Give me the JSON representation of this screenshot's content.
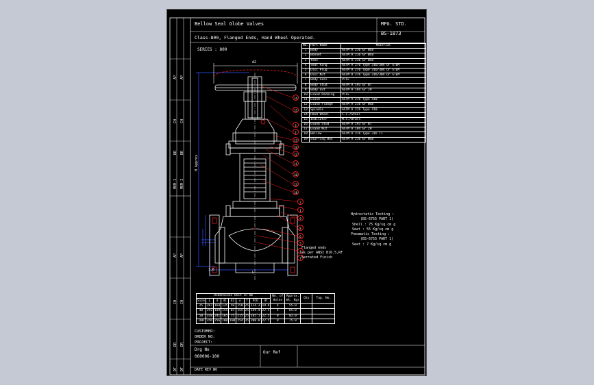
{
  "header": {
    "title": "Bellow Seal Globe Valves",
    "subtitle": "Class-800, Flanged Ends, Hand Wheel Operated.",
    "std_label": "MFG. STD.",
    "std_value": "BS-1873",
    "series": "SERIES : 800"
  },
  "parts_table": {
    "headers": [
      "No.",
      "Part Name",
      "Material"
    ],
    "rows": [
      [
        "1",
        "Body",
        "ASTM A 216 Gr WCB"
      ],
      [
        "2",
        "Bonnet",
        "ASTM A 216 Gr WCB"
      ],
      [
        "3",
        "Yoke",
        "ASTM A 216 Gr WCB"
      ],
      [
        "4",
        "Seat Ring",
        "ASTM A 276 Type 316/304 Or STEM"
      ],
      [
        "5",
        "Disc Plug",
        "ASTM A 276 Type 316/304 Or STEM"
      ],
      [
        "6",
        "Disc Nut",
        "ASTM A 276 Type 316/304 Or STEM"
      ],
      [
        "7",
        "Body Seal",
        "PTFE"
      ],
      [
        "8",
        "Body Stud",
        "ASTM A 193 Gr B7"
      ],
      [
        "9",
        "Body nut",
        "ASTM A 194 Gr 2H"
      ],
      [
        "10",
        "Gland Packing",
        "PTFE"
      ],
      [
        "11",
        "Gland",
        "ASTM A 276 Type 410"
      ],
      [
        "12",
        "Gland Flange",
        "ASTM A 216 Gr WCB"
      ],
      [
        "13",
        "Spindle",
        "ASTM A 276 Type 410"
      ],
      [
        "14",
        "Hand Wheel",
        "C.I./Steel"
      ],
      [
        "15",
        "Indicator",
        "M.S./Brass"
      ],
      [
        "16",
        "Gland Stud",
        "ASTM A 193 Gr B7"
      ],
      [
        "17",
        "Gland Nut",
        "ASTM A 194 Gr 2H"
      ],
      [
        "18",
        "Bellow",
        "ASTM A 276 Type 316 Ti"
      ],
      [
        "19",
        "Stuffing Box",
        "ASTM A 216 Gr WCB"
      ]
    ]
  },
  "notes": {
    "flanged_ends_1": "Flanged ends",
    "flanged_ends_2": "as per ANSI B16.5,RF",
    "flanged_ends_3": "Serrated Finish",
    "hydro_title": "Hydrostatic Testing :",
    "hydro_std": "(BS-6755 PART 1)",
    "hydro_shell": "Shell : 75 Kg/sq.cm g",
    "hydro_seat": "Seat : 55 Kg/sq.cm g",
    "pneu_title": "Pneumatic Testing :",
    "pneu_std": "(BS-6755 PART 1)",
    "pneu_seat": "Seat : 7 Kg/sq.cm g"
  },
  "drawing_labels": {
    "top_dim": "d2",
    "height_dim": "H Approx",
    "bottom_dim": "L",
    "left_dim": "1.6"
  },
  "callouts": [
    "14",
    "15",
    "3",
    "2",
    "17",
    "16",
    "12",
    "11",
    "10",
    "13",
    "18",
    "2",
    "1",
    "9",
    "8",
    "6",
    "5",
    "4",
    "7"
  ],
  "dim_table": {
    "caption": "Dimensions Unit in mm",
    "headers": [
      "Size",
      "L",
      "d",
      "d1",
      "d2",
      "n",
      "f",
      "PCD",
      "dt",
      "No. of Holes",
      "Approx. Wt. Kgs",
      "Qty",
      "Tag. No."
    ],
    "rows": [
      [
        "25",
        "267",
        "164",
        "125",
        "50",
        "150",
        "25",
        "114.3",
        "19.0",
        "4",
        "55.0",
        "",
        ""
      ],
      [
        "40",
        "292",
        "189",
        "155",
        "65",
        "155",
        "25",
        "149.4",
        "22.5",
        "4",
        "65.0",
        "",
        ""
      ],
      [
        "50",
        "318",
        "241",
        "165",
        "75",
        "215",
        "25",
        "165.1",
        "22.5",
        "8",
        "81.0",
        "",
        ""
      ],
      [
        "100",
        "356",
        "256",
        "180",
        "100",
        "254",
        "35",
        "200.0",
        "22.5",
        "8",
        "75.0",
        "",
        ""
      ]
    ]
  },
  "footer": {
    "customer": "CUSTOMER:",
    "order": "ORDER NO:",
    "project": "PROJECT:",
    "drg_label": "Drg No",
    "drg_value": "060006-100",
    "our_ref": "Our Ref",
    "bottom_text": "DATE REV NO"
  },
  "sidebar": {
    "labels_top": [
      "AP",
      "CH",
      "DR",
      "MEM-I",
      "MEM-1"
    ],
    "labels_bottom": [
      "AP",
      "CH",
      "DR",
      "DT"
    ]
  }
}
